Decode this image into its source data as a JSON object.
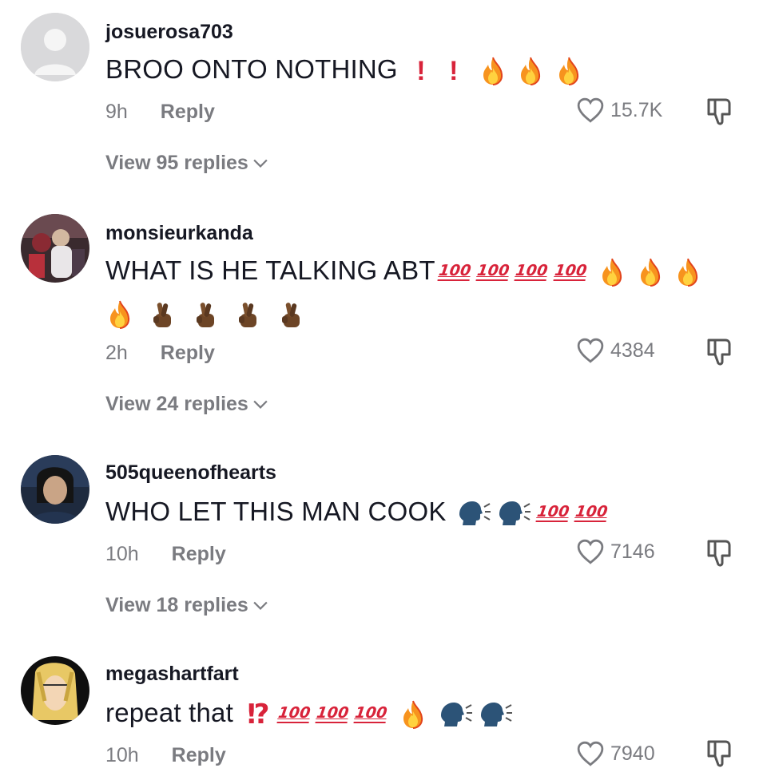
{
  "comments": [
    {
      "username": "josuerosa703",
      "text": "BROO ONTO NOTHING",
      "time": "9h",
      "reply_label": "Reply",
      "likes": "15.7K",
      "view_replies": "View 95 replies"
    },
    {
      "username": "monsieurkanda",
      "text": "WHAT IS HE TALKING ABT",
      "time": "2h",
      "reply_label": "Reply",
      "likes": "4384",
      "view_replies": "View 24 replies"
    },
    {
      "username": "505queenofhearts",
      "text": "WHO LET THIS MAN COOK",
      "time": "10h",
      "reply_label": "Reply",
      "likes": "7146",
      "view_replies": "View 18 replies"
    },
    {
      "username": "megashartfart",
      "text": "repeat that",
      "time": "10h",
      "reply_label": "Reply",
      "likes": "7940"
    }
  ],
  "emoji": {
    "hundred_text": "100",
    "exclamation": "!",
    "interrobang": "⁉"
  },
  "colors": {
    "text": "#161823",
    "muted": "#7a7b80",
    "emoji_red": "#d8233a",
    "fire_orange": "#f7931e"
  },
  "icons": [
    "heart-icon",
    "thumbs-down-icon",
    "chevron-down-icon",
    "fire-emoji",
    "hundred-emoji",
    "crossed-fingers-emoji",
    "speaking-head-emoji",
    "exclamation-emoji"
  ]
}
